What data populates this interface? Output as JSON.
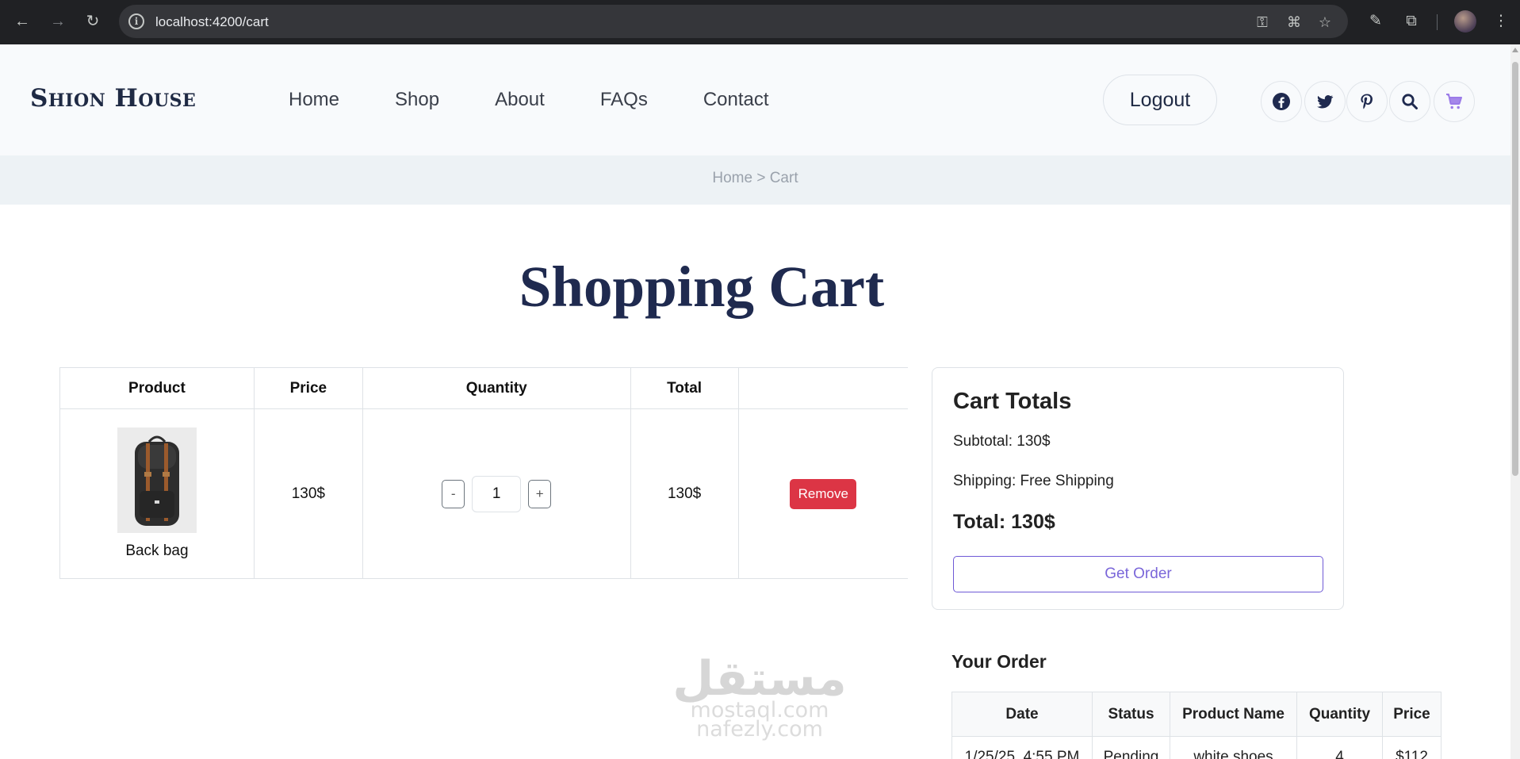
{
  "browser": {
    "url": "localhost:4200/cart"
  },
  "header": {
    "logo": "Shion House",
    "nav": [
      "Home",
      "Shop",
      "About",
      "FAQs",
      "Contact"
    ],
    "logout": "Logout",
    "accent_color": "#9b7be8"
  },
  "breadcrumb": "Home > Cart",
  "page_title": "Shopping Cart",
  "cart_table": {
    "headers": [
      "Product",
      "Price",
      "Quantity",
      "Total",
      ""
    ],
    "rows": [
      {
        "product_name": "Back bag",
        "price": "130$",
        "qty_minus": "-",
        "quantity": "1",
        "qty_plus": "+",
        "total": "130$",
        "remove": "Remove"
      }
    ]
  },
  "totals": {
    "title": "Cart Totals",
    "subtotal": "Subtotal: 130$",
    "shipping": "Shipping: Free Shipping",
    "total": "Total: 130$",
    "button": "Get Order"
  },
  "your_order": {
    "title": "Your Order",
    "headers": [
      "Date",
      "Status",
      "Product Name",
      "Quantity",
      "Price"
    ],
    "rows": [
      [
        "1/25/25, 4:55 PM",
        "Pending",
        "white shoes",
        "4",
        "$112"
      ]
    ]
  },
  "watermark": {
    "brand": "مستقل",
    "line1": "mostaql.com",
    "line2": "nafezly.com"
  }
}
